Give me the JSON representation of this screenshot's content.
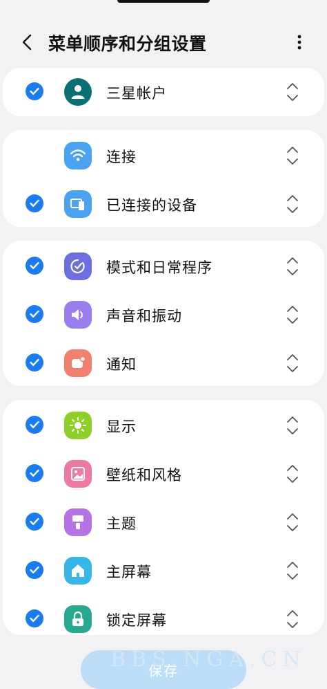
{
  "header": {
    "title": "菜单顺序和分组设置",
    "back_icon": "chevron-left-icon",
    "more_icon": "more-vertical-icon"
  },
  "groups": [
    {
      "items": [
        {
          "id": "account",
          "label": "三星帐户",
          "checked": true,
          "icon": "account-icon",
          "icon_color": "#0a6f72"
        }
      ]
    },
    {
      "items": [
        {
          "id": "connections",
          "label": "连接",
          "checked": false,
          "icon": "wifi-icon",
          "icon_color": "#4aa3f0"
        },
        {
          "id": "connected-devices",
          "label": "已连接的设备",
          "checked": true,
          "icon": "devices-icon",
          "icon_color": "#4aa3f0"
        }
      ]
    },
    {
      "items": [
        {
          "id": "modes-routines",
          "label": "模式和日常程序",
          "checked": true,
          "icon": "routines-icon",
          "icon_color": "#6b6fe0"
        },
        {
          "id": "sounds",
          "label": "声音和振动",
          "checked": true,
          "icon": "speaker-icon",
          "icon_color": "#9a7ef0"
        },
        {
          "id": "notifications",
          "label": "通知",
          "checked": true,
          "icon": "notification-icon",
          "icon_color": "#f2806f"
        }
      ]
    },
    {
      "items": [
        {
          "id": "display",
          "label": "显示",
          "checked": true,
          "icon": "sun-icon",
          "icon_color": "#8fcf2a"
        },
        {
          "id": "wallpaper",
          "label": "壁纸和风格",
          "checked": true,
          "icon": "image-icon",
          "icon_color": "#ee7aa0"
        },
        {
          "id": "themes",
          "label": "主题",
          "checked": true,
          "icon": "brush-icon",
          "icon_color": "#b673e6"
        },
        {
          "id": "home-screen",
          "label": "主屏幕",
          "checked": true,
          "icon": "home-icon",
          "icon_color": "#38b6e8"
        },
        {
          "id": "lock-screen",
          "label": "锁定屏幕",
          "checked": true,
          "icon": "lock-icon",
          "icon_color": "#28a98f"
        }
      ]
    }
  ],
  "footer": {
    "save_label": "保存",
    "watermark": "BBS.NGA.CN"
  },
  "colors": {
    "check": "#1a7cf0",
    "background": "#f2f2f4",
    "save_button": "#bcdcf8"
  }
}
